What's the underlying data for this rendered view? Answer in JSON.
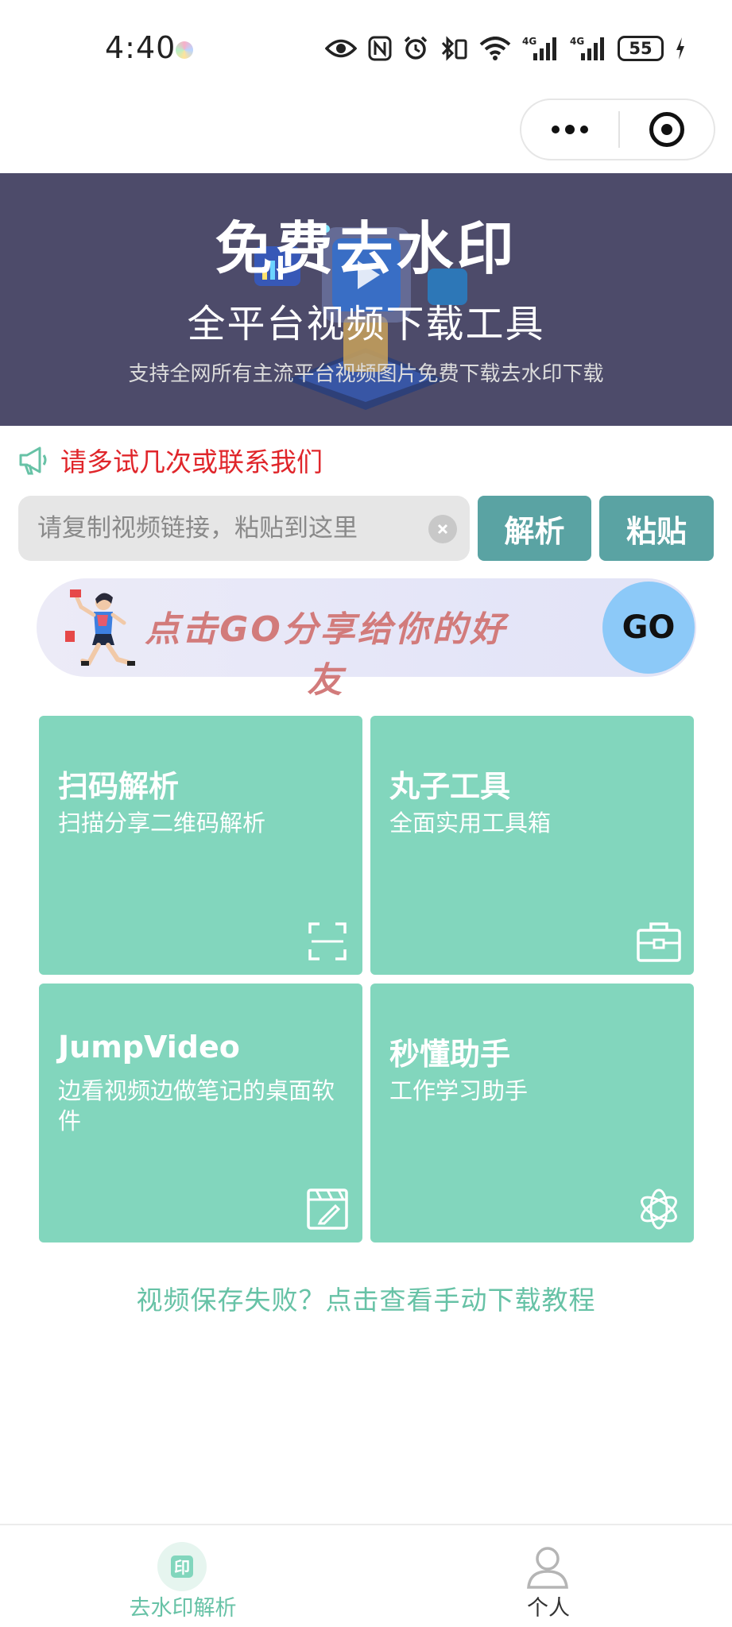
{
  "status_bar": {
    "time": "4:40",
    "network_1": "4G",
    "network_2": "4G",
    "battery": "55",
    "icons": [
      "eye-icon",
      "nfc-icon",
      "alarm-icon",
      "bluetooth-icon",
      "wifi-icon",
      "signal-icon",
      "signal-icon",
      "battery-icon",
      "charging-icon"
    ]
  },
  "capsule": {
    "more_icon": "more-dots-icon",
    "close_icon": "target-close-icon"
  },
  "banner": {
    "title": "免费去水印",
    "subtitle": "全平台视频下载工具",
    "description": "支持全网所有主流平台视频图片免费下载去水印下载"
  },
  "notice": {
    "icon": "megaphone-icon",
    "text": "请多试几次或联系我们"
  },
  "input": {
    "placeholder": "请复制视频链接，粘贴到这里",
    "value": ""
  },
  "buttons": {
    "parse": "解析",
    "paste": "粘贴"
  },
  "share": {
    "text": "点击GO分享给你的好友",
    "go": "GO"
  },
  "cards": [
    {
      "title": "扫码解析",
      "desc": "扫描分享二维码解析",
      "icon": "scan-icon"
    },
    {
      "title": "丸子工具",
      "desc": "全面实用工具箱",
      "icon": "toolbox-icon"
    },
    {
      "title": "JumpVideo",
      "desc": "边看视频边做笔记的桌面软件",
      "icon": "clapper-icon"
    },
    {
      "title": "秒懂助手",
      "desc": "工作学习助手",
      "icon": "ai-knot-icon"
    }
  ],
  "help_link": "视频保存失败？点击查看手动下载教程",
  "tabbar": {
    "items": [
      {
        "label": "去水印解析",
        "icon": "watermark-icon",
        "active": true
      },
      {
        "label": "个人",
        "icon": "person-icon",
        "active": false
      }
    ]
  },
  "colors": {
    "banner_bg": "#4d4b6a",
    "accent_teal": "#5aa3a3",
    "card_green": "#82d6bd",
    "link_green": "#67c2a6",
    "notice_red": "#e0262b",
    "go_blue": "#8cc9f8"
  }
}
